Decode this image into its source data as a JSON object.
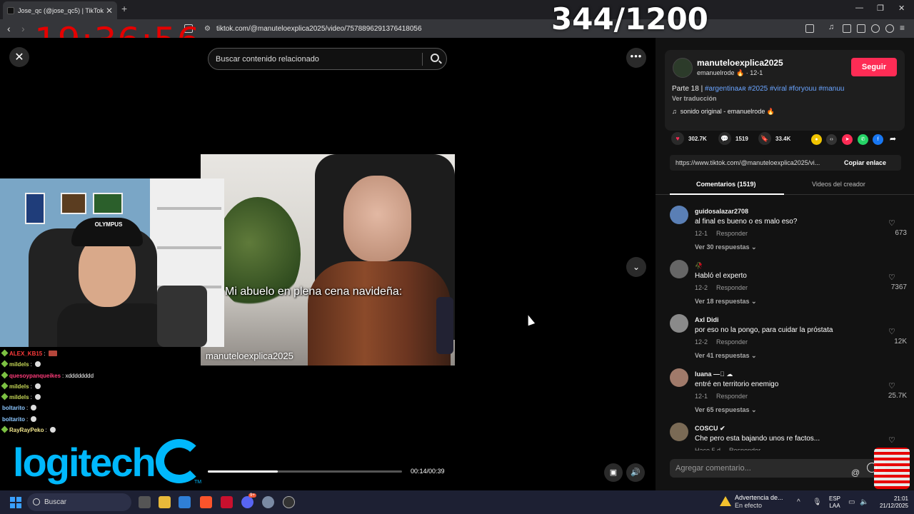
{
  "browser": {
    "tab_title": "Jose_qc (@jose_qc5) | TikTok",
    "tab_close": "✕",
    "new_tab": "+",
    "url": "tiktok.com/@manuteloexplica2025/video/7578896291376418056",
    "window_controls": [
      "—",
      "❐",
      "✕"
    ]
  },
  "overlay": {
    "clock": "19:36:56",
    "counter": "344/1200"
  },
  "video": {
    "search_placeholder": "Buscar contenido relacionado",
    "caption": "Mi abuelo en plena cena navideña:",
    "watermark": "manuteloexplica2025",
    "time": "00:14/00:39",
    "progress": 0.36,
    "more_label": "•••",
    "down_label": "⌄",
    "close_label": "✕"
  },
  "webcam": {
    "cap_text": "OLYMPUS"
  },
  "chat": [
    {
      "user": "ALEX_KB15",
      "color": "#ff3b3b",
      "msg": "",
      "emote": "square",
      "badge": true
    },
    {
      "user": "mildels",
      "color": "#c8d957",
      "msg": "",
      "emote": "round",
      "badge": true
    },
    {
      "user": "quesoypanqueikes",
      "color": "#ff3b7a",
      "msg": "xdddddddd",
      "emote": "",
      "badge": true
    },
    {
      "user": "mildels",
      "color": "#c8d957",
      "msg": "",
      "emote": "round",
      "badge": true
    },
    {
      "user": "mildels",
      "color": "#c8d957",
      "msg": "",
      "emote": "round",
      "badge": true
    },
    {
      "user": "boltarito",
      "color": "#8cc7ff",
      "msg": "",
      "emote": "round",
      "badge": false
    },
    {
      "user": "boltarito",
      "color": "#8cc7ff",
      "msg": "",
      "emote": "round",
      "badge": false
    },
    {
      "user": "RayRayPeko",
      "color": "#f2e68c",
      "msg": "",
      "emote": "round",
      "badge": true
    }
  ],
  "logitech": {
    "text": "logitech",
    "tm": "TM"
  },
  "panel": {
    "username": "manuteloexplica2025",
    "subline": "emanuelrode 🔥 · 12-1",
    "follow_label": "Seguir",
    "desc_prefix": "Parte 18 | ",
    "desc_tags": "#argentinaᴀʀ #2025 #viral #foryouu #manuu",
    "translate": "Ver traducción",
    "sound_note": "♫",
    "sound": "sonido original - emanuelrode 🔥",
    "likes": "302.7K",
    "comments_count": "1519",
    "saves": "33.4K",
    "link": "https://www.tiktok.com/@manuteloexplica2025/vi...",
    "copy_label": "Copiar enlace",
    "tab_comments": "Comentarios (1519)",
    "tab_videos": "Videos del creador",
    "comment_placeholder": "Agregar comentario...",
    "at_symbol": "@"
  },
  "comments": [
    {
      "user": "guidosalazar2708",
      "text": "al final es bueno o es malo eso?",
      "date": "12-1",
      "reply": "Responder",
      "views": "Ver 30 respuestas ⌄",
      "likes": "673",
      "avatar": "#5a7fb5"
    },
    {
      "user": "🥀",
      "text": "Habló el experto",
      "date": "12-2",
      "reply": "Responder",
      "views": "Ver 18 respuestas ⌄",
      "likes": "7367",
      "avatar": "#666666"
    },
    {
      "user": "Axl Didi",
      "text": "por eso no la pongo, para cuidar la próstata",
      "date": "12-2",
      "reply": "Responder",
      "views": "Ver 41 respuestas ⌄",
      "likes": "12K",
      "avatar": "#8a8a8a"
    },
    {
      "user": "luana —🏻 ☁",
      "text": "entré en territorio enemigo",
      "date": "12-1",
      "reply": "Responder",
      "views": "Ver 65 respuestas ⌄",
      "likes": "25.7K",
      "avatar": "#a07a6a"
    },
    {
      "user": "COSCU ✔",
      "text": "Che pero esta bajando unos re factos...",
      "date": "Hace 5 d",
      "reply": "Responder",
      "views": "",
      "likes": "",
      "avatar": "#7a6a55"
    }
  ],
  "taskbar": {
    "search": "Buscar",
    "warning_title": "Advertencia de...",
    "warning_sub": "En efecto",
    "lang1": "ESP",
    "lang2": "LAA",
    "time": "21:01",
    "date": "21/12/2025",
    "badge": "9+"
  }
}
